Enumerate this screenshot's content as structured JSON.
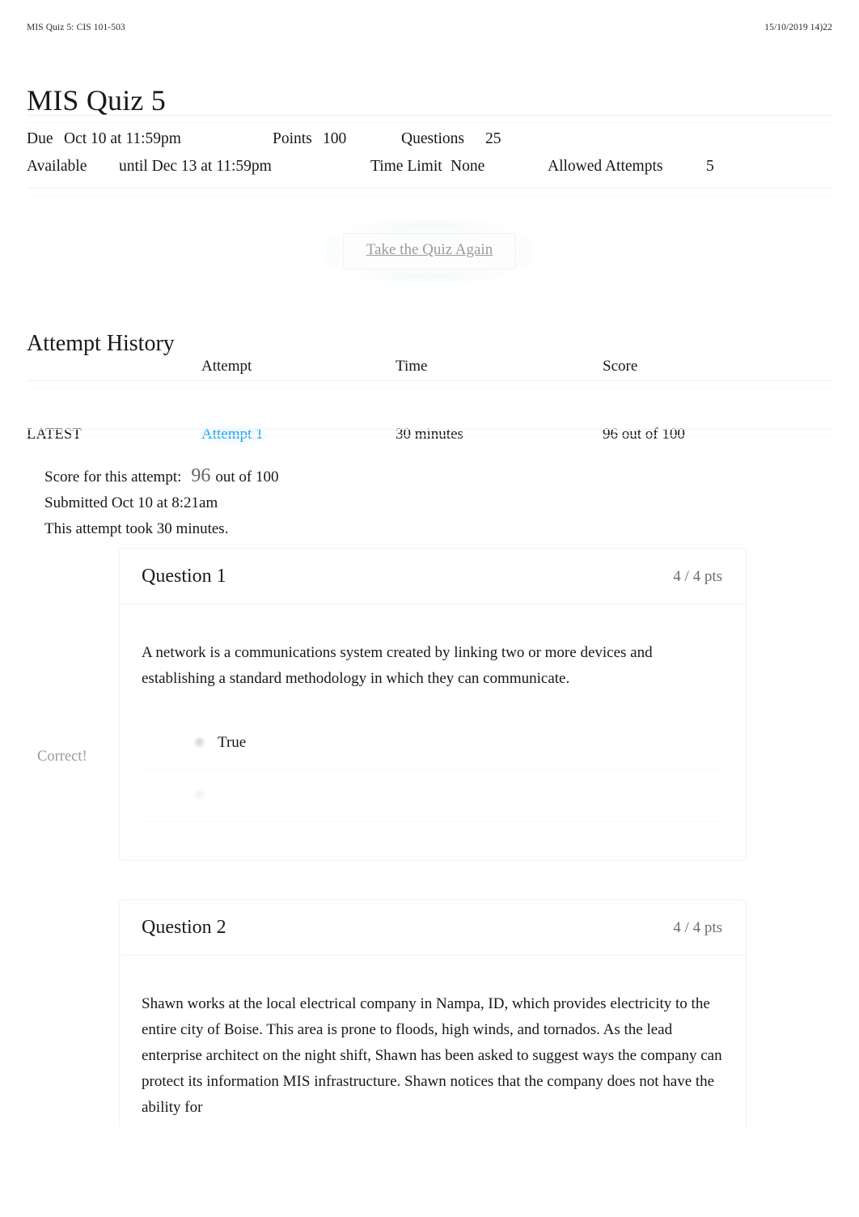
{
  "print_header": {
    "document_title": "MIS Quiz 5: CIS 101-503",
    "timestamp": "15/10/2019 14)22"
  },
  "page_title": "MIS Quiz 5",
  "quiz_meta": {
    "due_label": "Due",
    "due_value": "Oct 10 at 11:59pm",
    "points_label": "Points",
    "points_value": "100",
    "questions_label": "Questions",
    "questions_value": "25",
    "available_label": "Available",
    "available_value": "until Dec 13 at 11:59pm",
    "time_limit_label": "Time Limit",
    "time_limit_value": "None",
    "allowed_attempts_label": "Allowed Attempts",
    "allowed_attempts_value": "5"
  },
  "actions": {
    "take_quiz_again": "Take the Quiz Again"
  },
  "attempt_history": {
    "heading": "Attempt History",
    "columns": [
      "",
      "Attempt",
      "Time",
      "Score"
    ],
    "rows": [
      {
        "flag": "LATEST",
        "attempt": "Attempt 1",
        "time": "30 minutes",
        "score": "96 out of 100"
      }
    ]
  },
  "attempt_summary": {
    "score_label": "Score for this attempt:",
    "score_value": "96",
    "score_suffix": "out of 100",
    "submitted": "Submitted Oct 10 at 8:21am",
    "duration": "This attempt took 30 minutes."
  },
  "questions": [
    {
      "title": "Question 1",
      "points": "4 / 4 pts",
      "text": "A network is a communications system created by linking two or more devices and establishing a standard methodology in which they can communicate.",
      "result_label": "Correct!",
      "answers": [
        {
          "label": "True",
          "selected": true
        },
        {
          "label": "",
          "selected": false
        }
      ]
    },
    {
      "title": "Question 2",
      "points": "4 / 4 pts",
      "text": "Shawn works at the local electrical company in Nampa, ID, which provides electricity to the entire city of Boise. This area is prone to floods, high winds, and tornados. As the lead enterprise architect on the night shift, Shawn has been asked to suggest ways the company can protect its information MIS infrastructure. Shawn notices that the company does not have the ability for"
    }
  ],
  "colors": {
    "link": "#20a6f0",
    "muted_text": "#9b9b9b",
    "points_text": "#6d6d6d",
    "body_text": "#17171a",
    "divider": "#f0f0f0"
  }
}
